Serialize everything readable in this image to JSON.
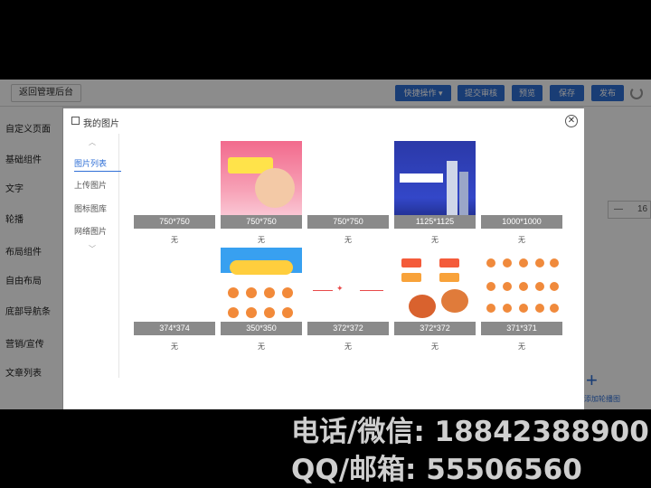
{
  "app": {
    "back_label": "返回管理后台",
    "toolbar": [
      "快捷操作 ▾",
      "提交审核",
      "预览",
      "保存",
      "发布"
    ],
    "left_nav": [
      "自定义页面",
      "基础组件",
      "文字",
      "轮播",
      "布局组件",
      "自由布局",
      "底部导航条",
      "营销/宣传",
      "文章列表"
    ],
    "stepper": {
      "minus": "—",
      "value": "16"
    },
    "add_label": "添加轮播图"
  },
  "modal": {
    "title": "我的图片",
    "close": "✕",
    "side_items": [
      "图片列表",
      "上传图片",
      "图标图库",
      "网络图片"
    ],
    "images": [
      {
        "size": "750*750",
        "caption": "无"
      },
      {
        "size": "750*750",
        "caption": "无"
      },
      {
        "size": "750*750",
        "caption": "无"
      },
      {
        "size": "1125*1125",
        "caption": "无"
      },
      {
        "size": "1000*1000",
        "caption": "无"
      },
      {
        "size": "374*374",
        "caption": "无"
      },
      {
        "size": "350*350",
        "caption": "无"
      },
      {
        "size": "372*372",
        "caption": "无"
      },
      {
        "size": "372*372",
        "caption": "无"
      },
      {
        "size": "371*371",
        "caption": "无"
      }
    ]
  },
  "watermark": {
    "line1": "电话/微信: 18842388900",
    "line2": "QQ/邮箱: 55506560"
  }
}
